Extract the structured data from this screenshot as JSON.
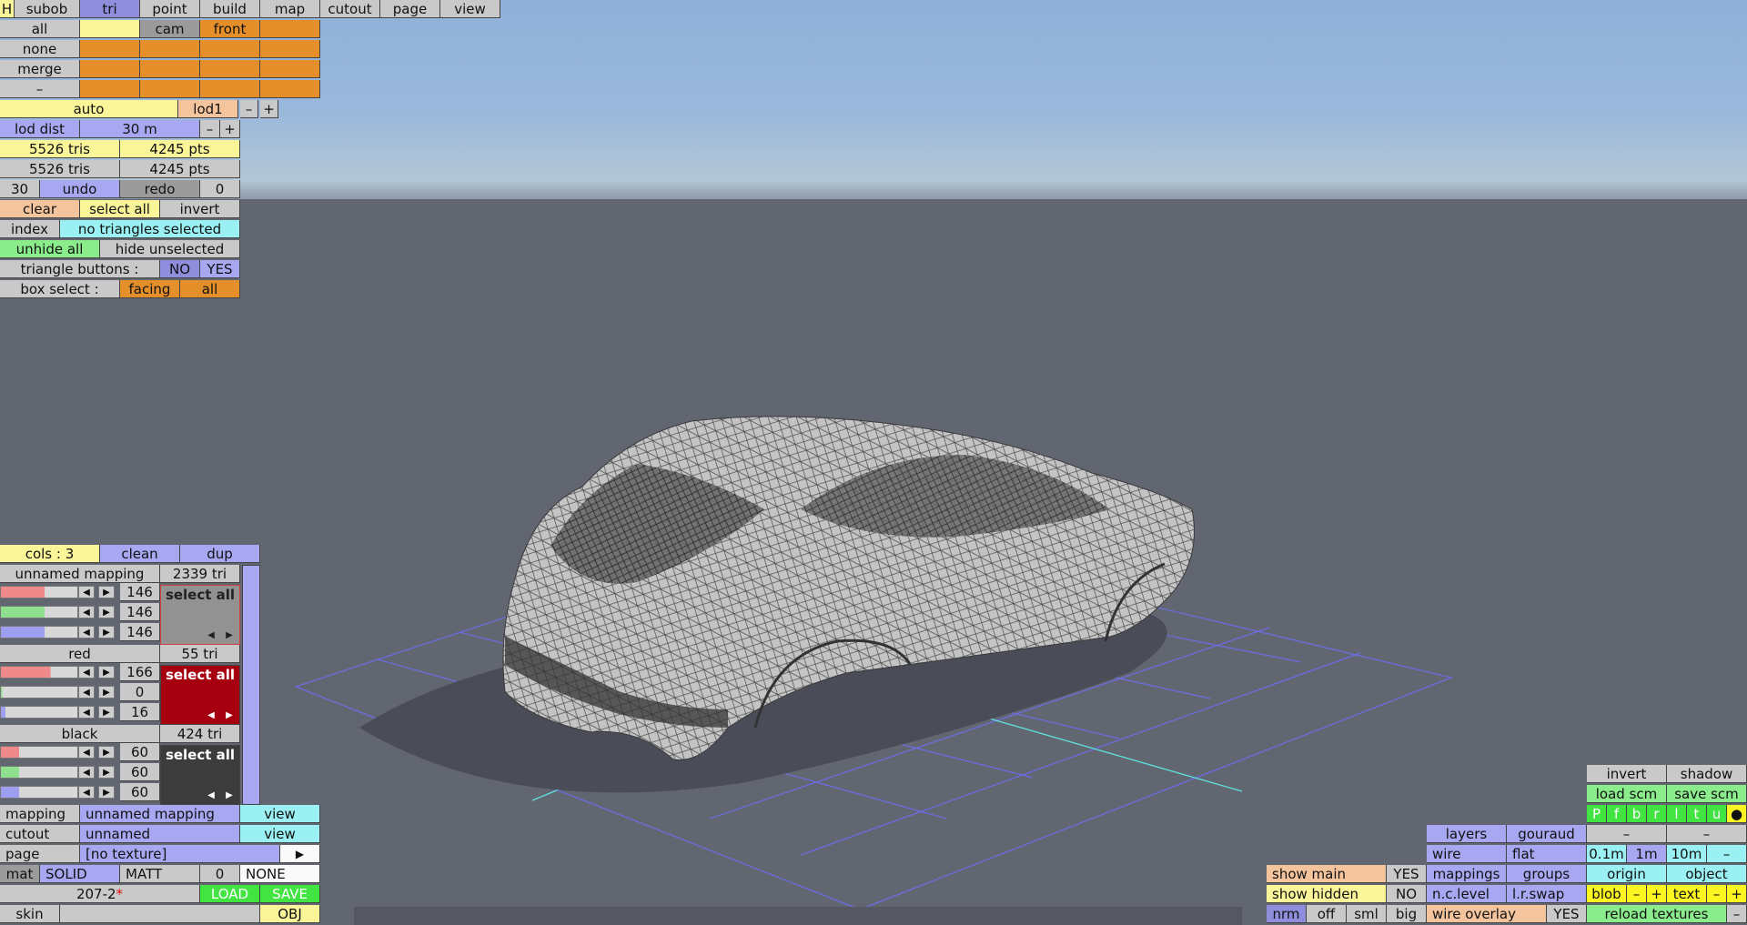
{
  "menu": {
    "h": "H",
    "subob": "subob",
    "tri": "tri",
    "point": "point",
    "build": "build",
    "map": "map",
    "cutout": "cutout",
    "page": "page",
    "view": "view"
  },
  "left_rows": {
    "all": "all",
    "none": "none",
    "merge": "merge",
    "dash": "–",
    "cam": "cam",
    "front": "front"
  },
  "lod": {
    "auto": "auto",
    "lod1": "lod1",
    "minus": "–",
    "plus": "+",
    "dist_label": "lod dist",
    "dist_value": "30 m"
  },
  "counts": {
    "tris1": "5526 tris",
    "pts1": "4245 pts",
    "tris2": "5526 tris",
    "pts2": "4245 pts"
  },
  "undo_row": {
    "undo_count": "30",
    "undo": "undo",
    "redo": "redo",
    "redo_count": "0"
  },
  "selection": {
    "clear": "clear",
    "select_all": "select all",
    "invert": "invert",
    "index": "index",
    "status": "no triangles selected",
    "unhide_all": "unhide all",
    "hide_unselected": "hide unselected"
  },
  "triangle_buttons": {
    "label": "triangle buttons :",
    "no": "NO",
    "yes": "YES"
  },
  "box_select": {
    "label": "box select :",
    "facing": "facing",
    "all": "all"
  },
  "colors_panel": {
    "cols": "cols : 3",
    "clean": "clean",
    "dup": "dup",
    "groups": [
      {
        "name": "unnamed mapping",
        "tri": "2339 tri",
        "r": "146",
        "g": "146",
        "b": "146",
        "r_frac": 0.57,
        "g_frac": 0.57,
        "b_frac": 0.57,
        "swatch": "#929292",
        "select": "select all"
      },
      {
        "name": "red",
        "tri": "55 tri",
        "r": "166",
        "g": "0",
        "b": "16",
        "r_frac": 0.65,
        "g_frac": 0.0,
        "b_frac": 0.06,
        "swatch": "#a60010",
        "select": "select all"
      },
      {
        "name": "black",
        "tri": "424 tri",
        "r": "60",
        "g": "60",
        "b": "60",
        "r_frac": 0.24,
        "g_frac": 0.24,
        "b_frac": 0.24,
        "swatch": "#3c3c3c",
        "select": "select all"
      }
    ]
  },
  "bottom_left": {
    "mapping_label": "mapping",
    "mapping_value": "unnamed mapping",
    "mapping_view": "view",
    "cutout_label": "cutout",
    "cutout_value": "unnamed",
    "cutout_view": "view",
    "page_label": "page",
    "page_value": "[no texture]",
    "page_arrow": "▶",
    "mat": "mat",
    "solid": "SOLID",
    "matt": "MATT",
    "mat_num": "0",
    "none": "NONE",
    "file": "207-2",
    "modified": "*",
    "load": "LOAD",
    "save": "SAVE",
    "skin": "skin",
    "obj": "OBJ"
  },
  "bottom_right": {
    "invert": "invert",
    "shadow": "shadow",
    "load_scm": "load scm",
    "save_scm": "save scm",
    "views": [
      "P",
      "f",
      "b",
      "r",
      "l",
      "t",
      "u",
      "●"
    ],
    "layers": "layers",
    "gouraud": "gouraud",
    "dash1": "–",
    "dash2": "–",
    "wire": "wire",
    "flat": "flat",
    "s01": "0.1m",
    "s1": "1m",
    "s10": "10m",
    "sdash": "–",
    "show_main": "show main",
    "show_main_val": "YES",
    "mappings": "mappings",
    "groups": "groups",
    "origin": "origin",
    "object": "object",
    "show_hidden": "show hidden",
    "show_hidden_val": "NO",
    "nclevel": "n.c.level",
    "lrswap": "l.r.swap",
    "blob": "blob",
    "bminus": "–",
    "bplus": "+",
    "text": "text",
    "tminus": "–",
    "tplus": "+",
    "nrm": "nrm",
    "off": "off",
    "sml": "sml",
    "big": "big",
    "wire_overlay": "wire overlay",
    "wire_overlay_val": "YES",
    "reload": "reload textures",
    "rdash": "–"
  }
}
